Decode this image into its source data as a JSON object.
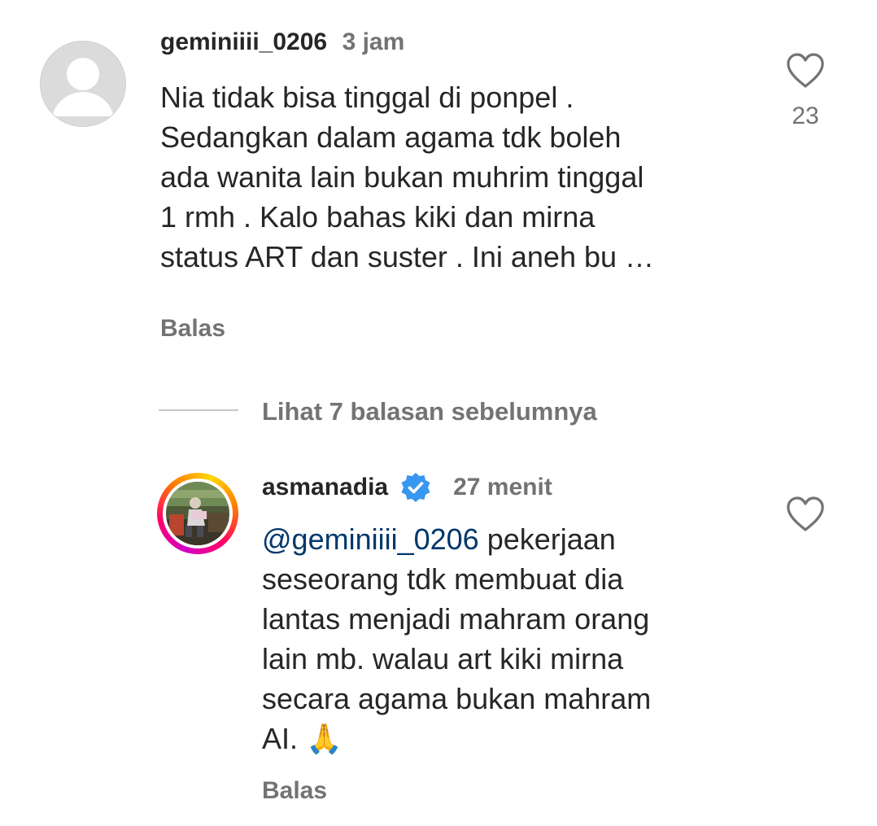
{
  "comment": {
    "username": "geminiiii_0206",
    "time": "3 jam",
    "text": "Nia tidak bisa tinggal di ponpel .\nSedangkan dalam agama tdk boleh\nada wanita lain bukan muhrim tinggal\n1 rmh . Kalo bahas kiki dan mirna\nstatus ART dan suster . Ini aneh bu …",
    "reply_label": "Balas",
    "like_count": "23",
    "avatar_icon": "default-avatar-icon"
  },
  "view_replies": {
    "label": "Lihat 7 balasan sebelumnya"
  },
  "reply": {
    "username": "asmanadia",
    "verified": true,
    "verified_color": "#3897f0",
    "time": "27 menit",
    "mention": "@geminiiii_0206",
    "text": " pekerjaan\nseseorang tdk membuat dia\nlantas menjadi mahram orang\nlain mb. walau art kiki mirna\nsecara agama bukan mahram\nAI. ",
    "emoji": "🙏",
    "reply_label": "Balas",
    "story_ring_colors": [
      "#d300c5",
      "#ff0069",
      "#ff7a00",
      "#ffd600"
    ]
  }
}
